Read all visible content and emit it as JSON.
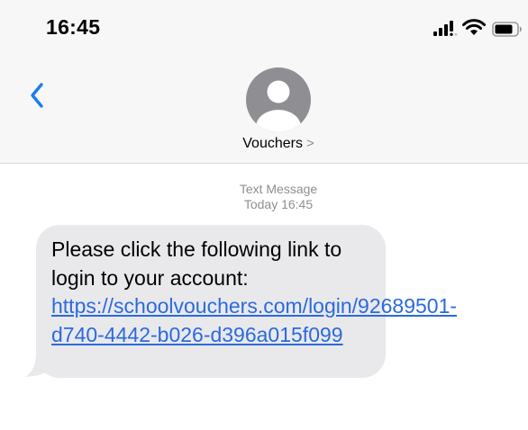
{
  "status_bar": {
    "time": "16:45",
    "icons": [
      "cellular-signal-icon",
      "wifi-icon",
      "battery-icon"
    ]
  },
  "header": {
    "back_icon": "chevron-left-icon",
    "avatar_icon": "person-silhouette-icon",
    "contact_name": "Vouchers",
    "contact_chevron": ">"
  },
  "conversation": {
    "meta_label": "Text Message",
    "meta_time": "Today 16:45",
    "messages": [
      {
        "direction": "incoming",
        "text": "Please click the following link to login to your account: ",
        "link": "https://schoolvouchers.com/login/92689501-d740-4442-b026-d396a015f099"
      }
    ]
  },
  "colors": {
    "header_background": "#f7f7f7",
    "accent": "#1a7cf5",
    "incoming_bubble": "#e9e9eb",
    "link": "#2a6adf",
    "meta_text": "#8e8e93",
    "avatar": "#8e8e93"
  }
}
